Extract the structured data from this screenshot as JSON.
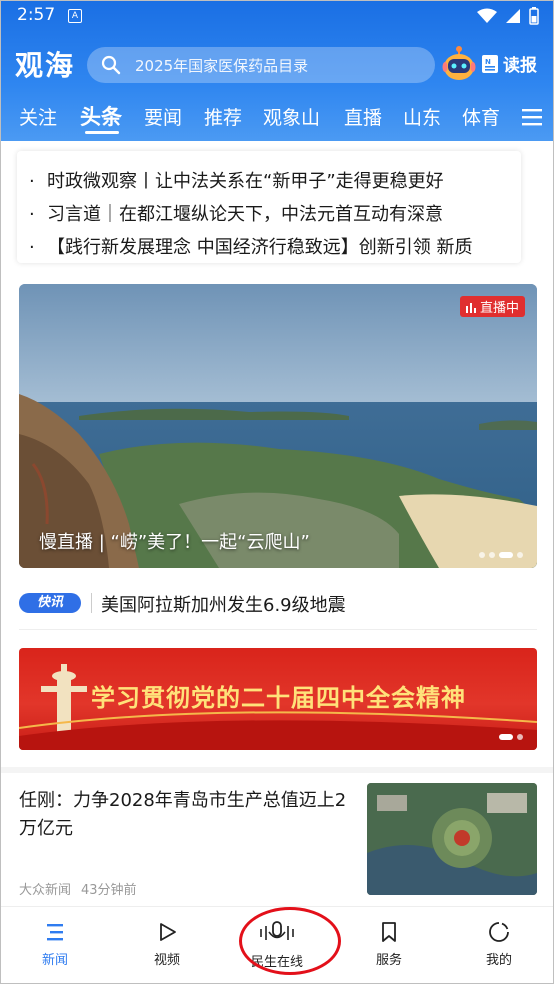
{
  "status_bar": {
    "time": "2:57",
    "notif_letter": "A"
  },
  "header": {
    "logo": "观海",
    "search_placeholder": "2025年国家医保药品目录",
    "read_label": "读报",
    "nav_tabs": [
      "关注",
      "头条",
      "要闻",
      "推荐",
      "观象山",
      "直播",
      "山东",
      "体育"
    ],
    "active_tab": "头条"
  },
  "headlines": [
    "时政微观察丨让中法关系在“新甲子”走得更稳更好",
    "习言道｜在都江堰纵论天下，中法元首互动有深意",
    "【践行新发展理念 中国经济行稳致远】创新引领 新质"
  ],
  "hero": {
    "badge": "直播中",
    "caption": "慢直播 | “崂”美了！一起“云爬山”"
  },
  "kuaixun": {
    "badge": "快讯",
    "text": "美国阿拉斯加州发生6.9级地震"
  },
  "banner": {
    "text": "学习贯彻党的二十届四中全会精神"
  },
  "article": {
    "title": "任刚：力争2028年青岛市生产总值迈上2万亿元",
    "source": "大众新闻",
    "time": "43分钟前"
  },
  "tabbar": [
    {
      "label": "新闻",
      "icon": "news-icon",
      "active": true
    },
    {
      "label": "视频",
      "icon": "play-icon",
      "active": false
    },
    {
      "label": "民生在线",
      "icon": "voice-mic-icon",
      "active": false
    },
    {
      "label": "服务",
      "icon": "bookmark-icon",
      "active": false
    },
    {
      "label": "我的",
      "icon": "profile-ring-icon",
      "active": false
    }
  ],
  "colors": {
    "brand_blue": "#2f7cf0",
    "live_red": "#e02f2f",
    "banner_red": "#d9241b",
    "banner_gold": "#ffe27a"
  }
}
